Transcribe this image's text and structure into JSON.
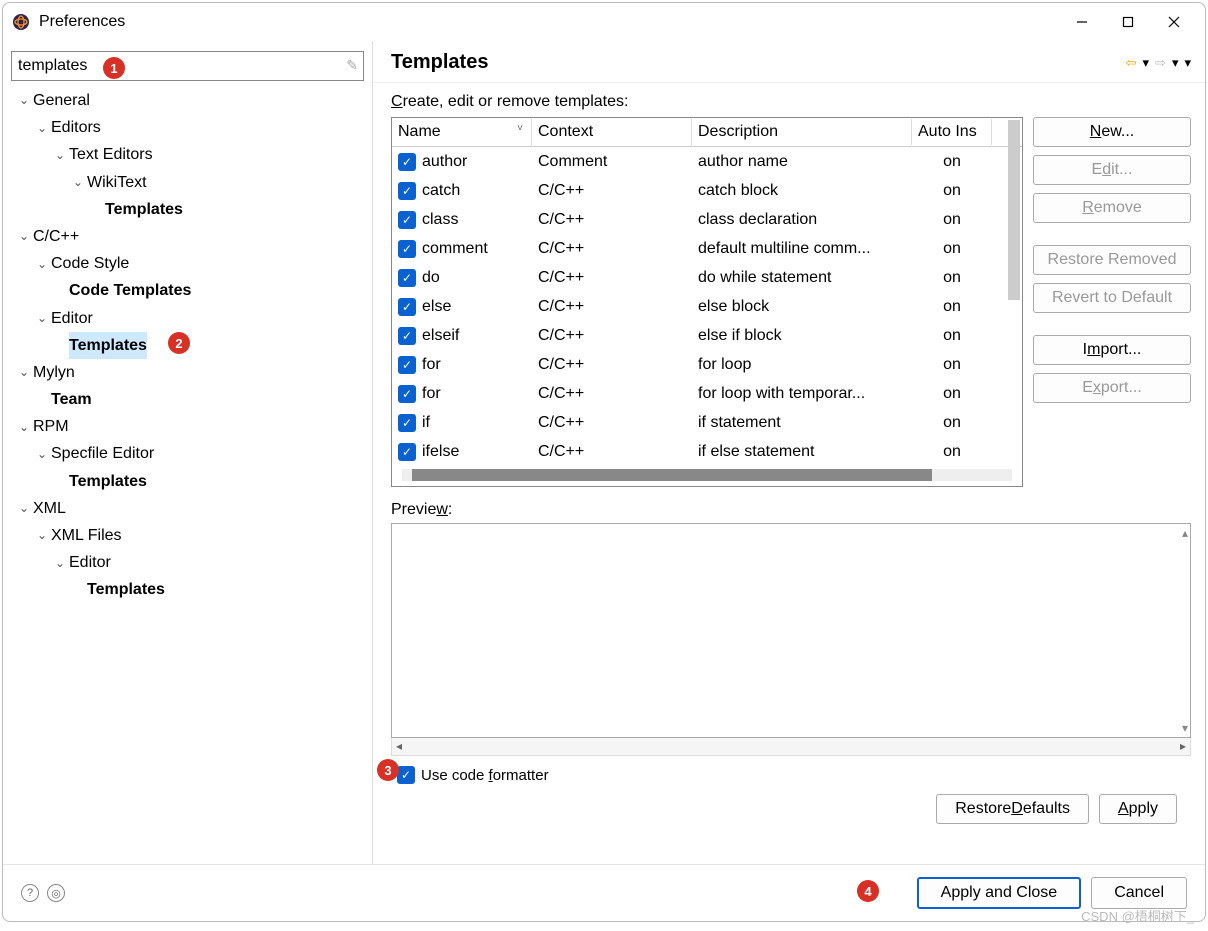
{
  "window": {
    "title": "Preferences"
  },
  "filter": {
    "value": "templates"
  },
  "tree": [
    {
      "label": "General",
      "lvl": 0,
      "exp": true
    },
    {
      "label": "Editors",
      "lvl": 1,
      "exp": true
    },
    {
      "label": "Text Editors",
      "lvl": 2,
      "exp": true
    },
    {
      "label": "WikiText",
      "lvl": 3,
      "exp": true
    },
    {
      "label": "Templates",
      "lvl": 4,
      "bold": true
    },
    {
      "label": "C/C++",
      "lvl": 0,
      "exp": true
    },
    {
      "label": "Code Style",
      "lvl": 1,
      "exp": true
    },
    {
      "label": "Code Templates",
      "lvl": 2,
      "bold": true
    },
    {
      "label": "Editor",
      "lvl": 1,
      "exp": true
    },
    {
      "label": "Templates",
      "lvl": 2,
      "bold": true,
      "selected": true
    },
    {
      "label": "Mylyn",
      "lvl": 0,
      "exp": true
    },
    {
      "label": "Team",
      "lvl": 1,
      "bold": true
    },
    {
      "label": "RPM",
      "lvl": 0,
      "exp": true
    },
    {
      "label": "Specfile Editor",
      "lvl": 1,
      "exp": true
    },
    {
      "label": "Templates",
      "lvl": 2,
      "bold": true
    },
    {
      "label": "XML",
      "lvl": 0,
      "exp": true
    },
    {
      "label": "XML Files",
      "lvl": 1,
      "exp": true
    },
    {
      "label": "Editor",
      "lvl": 2,
      "exp": true
    },
    {
      "label": "Templates",
      "lvl": 3,
      "bold": true
    }
  ],
  "page": {
    "title": "Templates",
    "section_label_pre": "C",
    "section_label_rest": "reate, edit or remove templates:",
    "columns": {
      "name": "Name",
      "context": "Context",
      "desc": "Description",
      "auto": "Auto Ins"
    },
    "rows": [
      {
        "name": "author",
        "ctx": "Comment",
        "desc": "author name",
        "auto": "on"
      },
      {
        "name": "catch",
        "ctx": "C/C++",
        "desc": "catch block",
        "auto": "on"
      },
      {
        "name": "class",
        "ctx": "C/C++",
        "desc": "class declaration",
        "auto": "on"
      },
      {
        "name": "comment",
        "ctx": "C/C++",
        "desc": "default multiline comm...",
        "auto": "on"
      },
      {
        "name": "do",
        "ctx": "C/C++",
        "desc": "do while statement",
        "auto": "on"
      },
      {
        "name": "else",
        "ctx": "C/C++",
        "desc": "else block",
        "auto": "on"
      },
      {
        "name": "elseif",
        "ctx": "C/C++",
        "desc": "else if block",
        "auto": "on"
      },
      {
        "name": "for",
        "ctx": "C/C++",
        "desc": "for loop",
        "auto": "on"
      },
      {
        "name": "for",
        "ctx": "C/C++",
        "desc": "for loop with temporar...",
        "auto": "on"
      },
      {
        "name": "if",
        "ctx": "C/C++",
        "desc": "if statement",
        "auto": "on"
      },
      {
        "name": "ifelse",
        "ctx": "C/C++",
        "desc": "if else statement",
        "auto": "on"
      }
    ],
    "buttons": {
      "new": "New...",
      "edit": "Edit...",
      "remove": "Remove",
      "restore_removed": "Restore Removed",
      "revert": "Revert to Default",
      "import": "Import...",
      "export": "Export..."
    },
    "preview_label_pre": "Previe",
    "preview_label_ul": "w",
    "preview_label_post": ":",
    "formatter_pre": "Use code ",
    "formatter_ul": "f",
    "formatter_post": "ormatter",
    "restore_defaults_pre": "Restore ",
    "restore_defaults_ul": "D",
    "restore_defaults_post": "efaults",
    "apply_pre": "",
    "apply_ul": "A",
    "apply_post": "pply"
  },
  "dialog": {
    "apply_close": "Apply and Close",
    "cancel": "Cancel"
  },
  "badges": {
    "b1": "1",
    "b2": "2",
    "b3": "3",
    "b4": "4"
  },
  "watermark": "CSDN @梧桐树下_"
}
